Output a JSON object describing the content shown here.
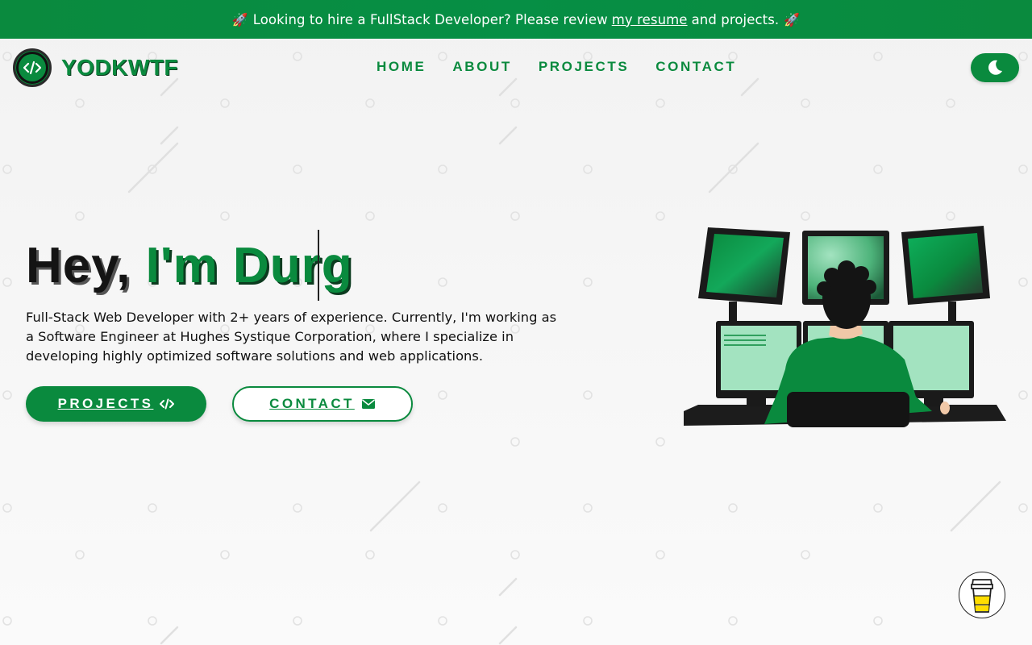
{
  "banner": {
    "text_before": "Looking to hire a FullStack Developer? Please review",
    "link_text": "my resume",
    "text_after": "and projects.",
    "rocket_icon": "🚀"
  },
  "brand": {
    "name": "YODKWTF",
    "logo_icon": "code-icon"
  },
  "nav": {
    "items": [
      {
        "label": "HOME"
      },
      {
        "label": "ABOUT"
      },
      {
        "label": "PROJECTS"
      },
      {
        "label": "CONTACT"
      }
    ],
    "theme_toggle_icon": "moon-icon"
  },
  "hero": {
    "greeting": "Hey,",
    "typed_text": "I'm Durg",
    "description": "Full-Stack Web Developer with 2+ years of experience. Currently, I'm working as a Software Engineer at Hughes Systique Corporation, where I specialize in developing highly optimized software solutions and web applications.",
    "buttons": {
      "projects": {
        "label": "PROJECTS",
        "icon": "code-icon"
      },
      "contact": {
        "label": "CONTACT",
        "icon": "envelope-icon"
      }
    },
    "illustration": "developer-at-monitors-illustration"
  },
  "floating": {
    "coffee_icon": "coffee-cup-icon"
  },
  "colors": {
    "primary": "#0a8a3e",
    "dark": "#141414",
    "light_green": "#a3e3c0"
  }
}
